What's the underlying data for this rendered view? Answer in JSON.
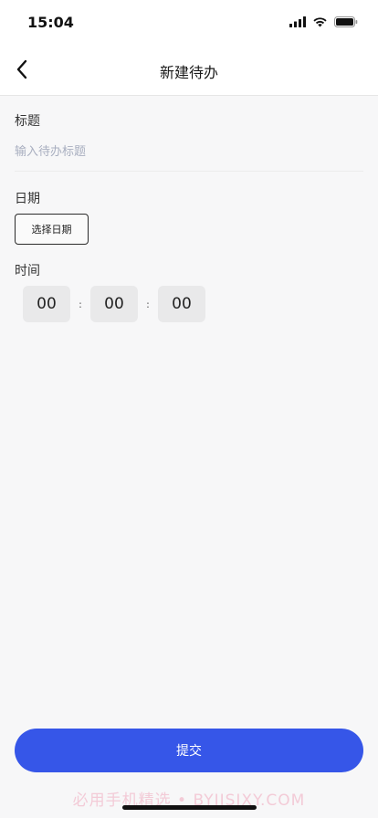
{
  "status_bar": {
    "time": "15:04",
    "icons": [
      "signal-icon",
      "wifi-icon",
      "battery-icon"
    ]
  },
  "nav": {
    "back_icon": "chevron-left-icon",
    "title": "新建待办"
  },
  "form": {
    "title_label": "标题",
    "title_placeholder": "输入待办标题",
    "title_value": "",
    "date_label": "日期",
    "date_button": "选择日期",
    "time_label": "时间",
    "time": {
      "hours": "00",
      "minutes": "00",
      "seconds": "00",
      "separator": ":"
    }
  },
  "submit_label": "提交",
  "watermark": "必用手机精选 • BYJISIXY.COM",
  "colors": {
    "accent": "#3656e8",
    "background": "#f7f7f8",
    "placeholder": "#a9afc0",
    "watermark": "#f3cbd7"
  }
}
